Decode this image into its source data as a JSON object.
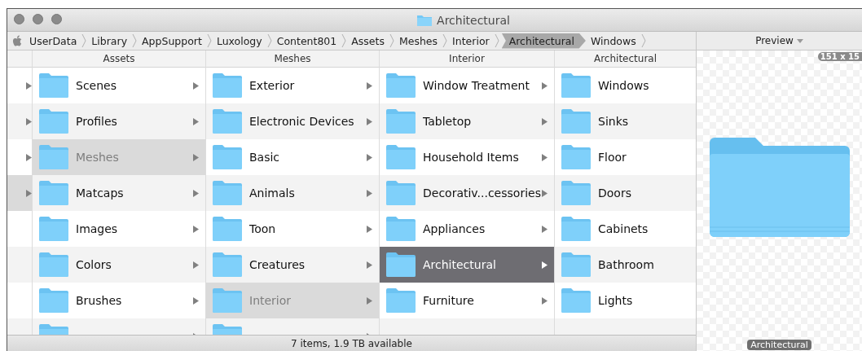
{
  "window": {
    "title": "Architectural"
  },
  "path_bar": [
    {
      "label": "UserData",
      "selected": false
    },
    {
      "label": "Library",
      "selected": false
    },
    {
      "label": "AppSupport",
      "selected": false
    },
    {
      "label": "Luxology",
      "selected": false
    },
    {
      "label": "Content801",
      "selected": false
    },
    {
      "label": "Assets",
      "selected": false
    },
    {
      "label": "Meshes",
      "selected": false
    },
    {
      "label": "Interior",
      "selected": false
    },
    {
      "label": "Architectural",
      "selected": true
    },
    {
      "label": "Windows",
      "selected": false
    }
  ],
  "columns": [
    {
      "items": [
        {
          "has_children": true,
          "selected": false
        },
        {
          "has_children": true,
          "selected": false
        },
        {
          "has_children": true,
          "selected": false
        },
        {
          "has_children": true,
          "selected": true
        }
      ]
    },
    {
      "header": "Assets",
      "items": [
        {
          "name": "Scenes",
          "has_children": true,
          "selected": false
        },
        {
          "name": "Profiles",
          "has_children": true,
          "selected": false
        },
        {
          "name": "Meshes",
          "has_children": true,
          "selected": true
        },
        {
          "name": "Matcaps",
          "has_children": true,
          "selected": false
        },
        {
          "name": "Images",
          "has_children": true,
          "selected": false
        },
        {
          "name": "Colors",
          "has_children": true,
          "selected": false
        },
        {
          "name": "Brushes",
          "has_children": true,
          "selected": false
        },
        {
          "has_children": true,
          "selected": false
        }
      ]
    },
    {
      "header": "Meshes",
      "items": [
        {
          "name": "Exterior",
          "has_children": true,
          "selected": false
        },
        {
          "name": "Electronic Devices",
          "has_children": true,
          "selected": false
        },
        {
          "name": "Basic",
          "has_children": true,
          "selected": false
        },
        {
          "name": "Animals",
          "has_children": true,
          "selected": false
        },
        {
          "name": "Toon",
          "has_children": true,
          "selected": false
        },
        {
          "name": "Creatures",
          "has_children": true,
          "selected": false
        },
        {
          "name": "Interior",
          "has_children": true,
          "selected": true
        },
        {
          "has_children": true,
          "selected": false
        }
      ]
    },
    {
      "header": "Interior",
      "items": [
        {
          "name": "Window Treatment",
          "has_children": true,
          "selected": false
        },
        {
          "name": "Tabletop",
          "has_children": true,
          "selected": false
        },
        {
          "name": "Household Items",
          "has_children": true,
          "selected": false
        },
        {
          "name": "Decorativ...cessories",
          "has_children": true,
          "selected": false
        },
        {
          "name": "Appliances",
          "has_children": true,
          "selected": false
        },
        {
          "name": "Architectural",
          "has_children": true,
          "selected": true
        },
        {
          "name": "Furniture",
          "has_children": true,
          "selected": false
        }
      ]
    },
    {
      "header": "Architectural",
      "items": [
        {
          "name": "Windows",
          "has_children": false,
          "selected": false
        },
        {
          "name": "Sinks",
          "has_children": false,
          "selected": false
        },
        {
          "name": "Floor",
          "has_children": false,
          "selected": false
        },
        {
          "name": "Doors",
          "has_children": false,
          "selected": false
        },
        {
          "name": "Cabinets",
          "has_children": false,
          "selected": false
        },
        {
          "name": "Bathroom",
          "has_children": false,
          "selected": false
        },
        {
          "name": "Lights",
          "has_children": false,
          "selected": false
        }
      ]
    }
  ],
  "preview": {
    "header": "Preview",
    "size_badge": "151 x 15",
    "caption": "Architectural"
  },
  "status_bar": "7 items, 1.9 TB available"
}
